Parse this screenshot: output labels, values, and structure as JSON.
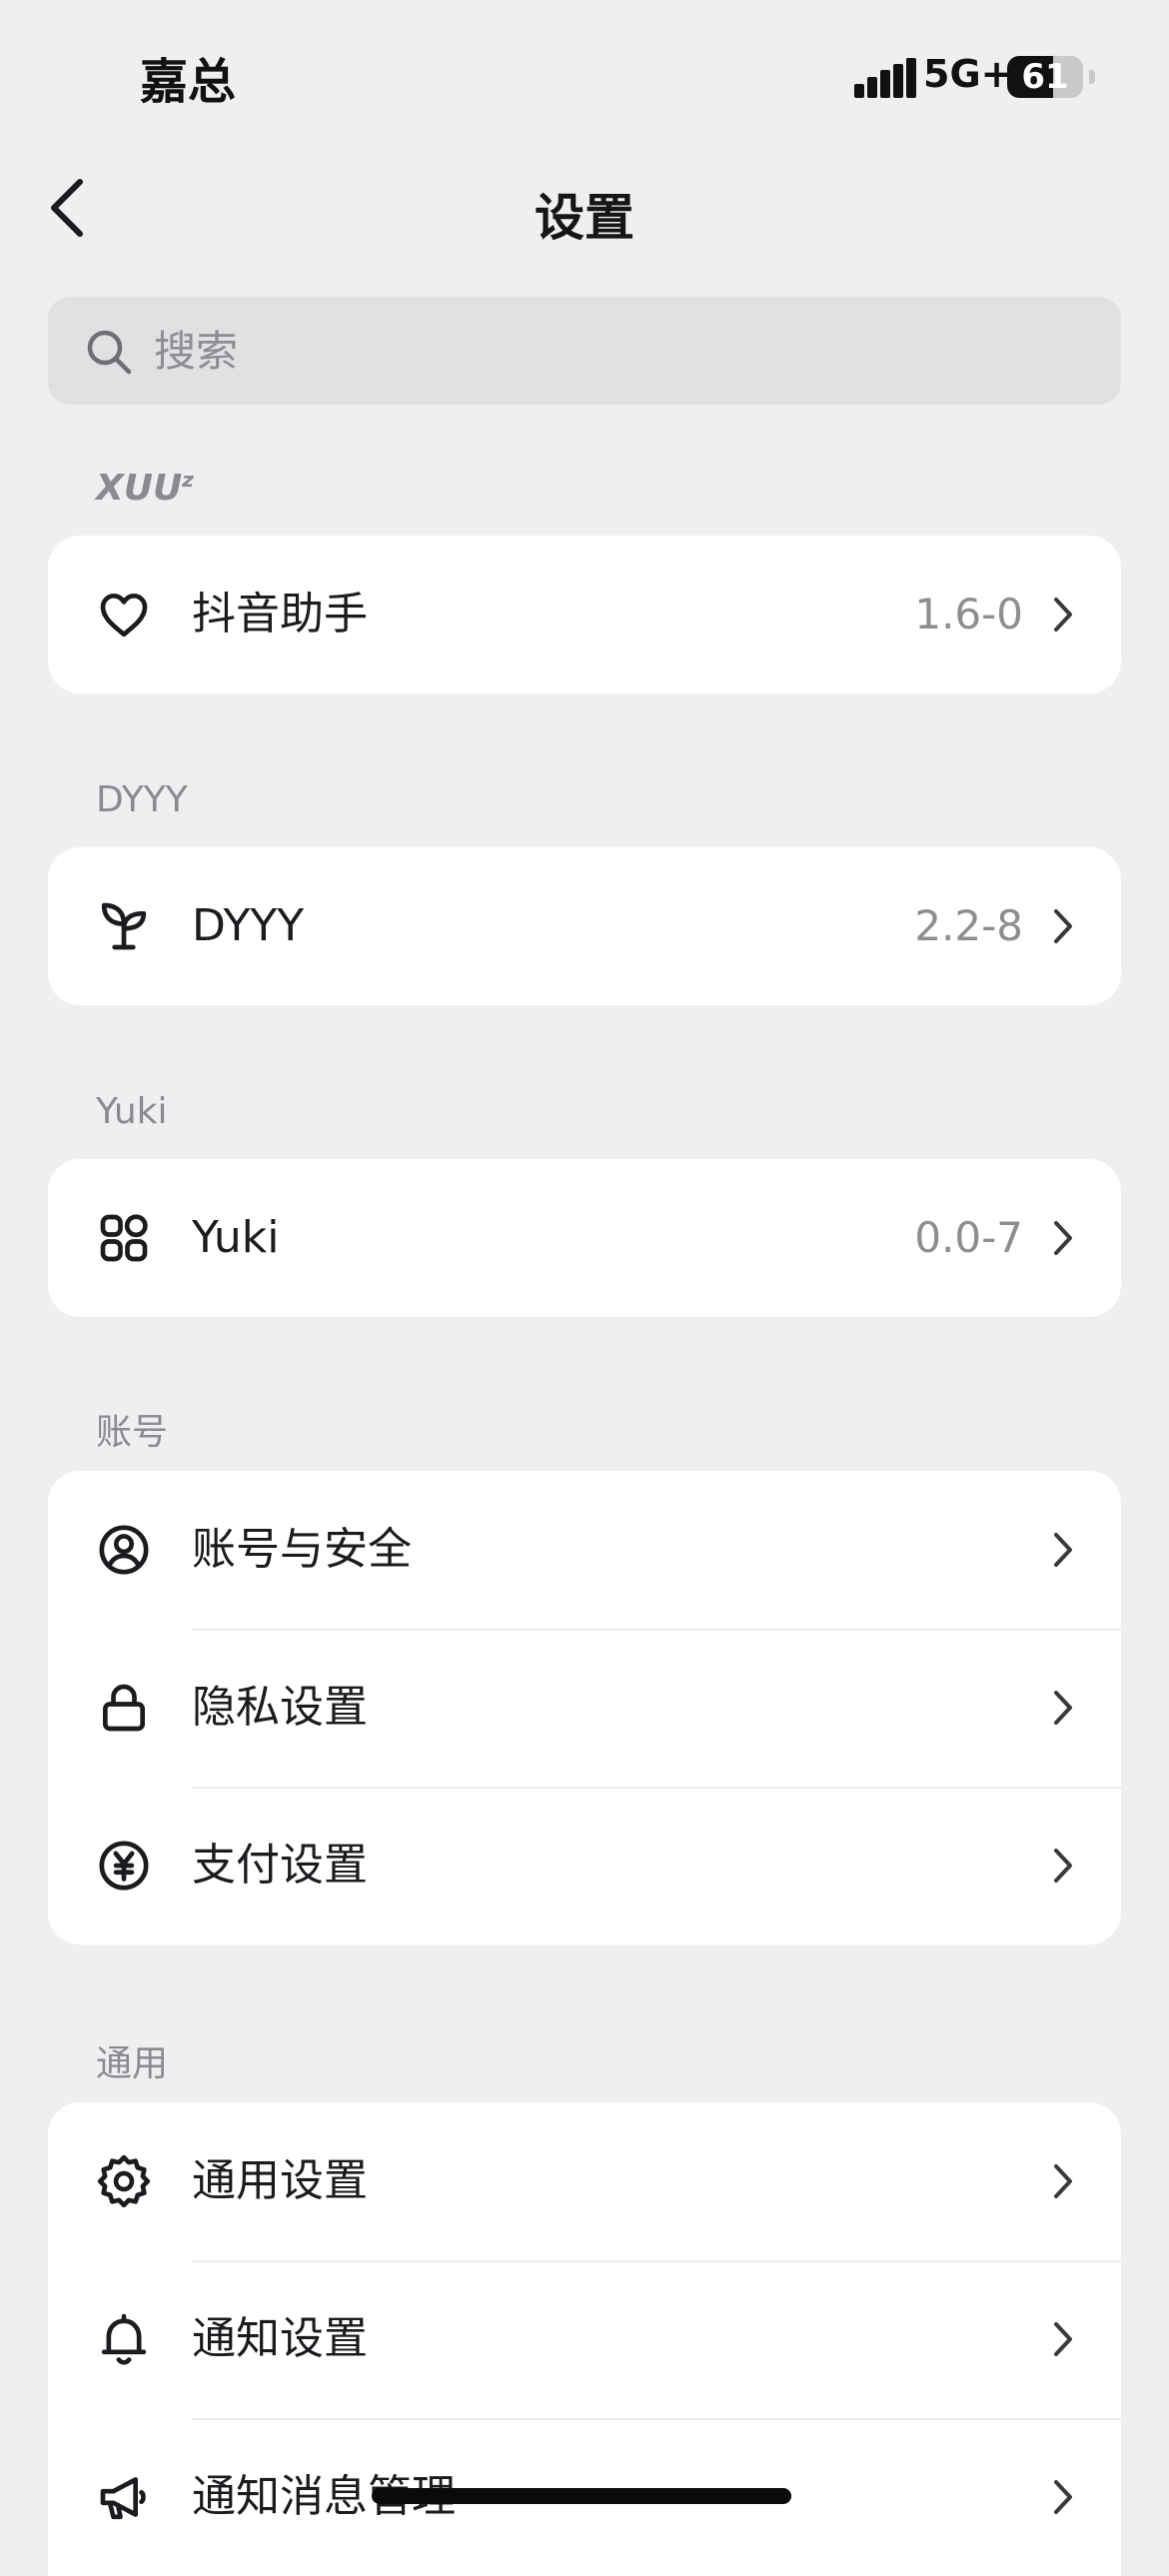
{
  "status_bar": {
    "carrier": "嘉总",
    "network": "5G+",
    "battery": "61",
    "battery_level": 0.61
  },
  "nav": {
    "title": "设置"
  },
  "search": {
    "placeholder": "搜索",
    "value": ""
  },
  "sections": {
    "xuuz": {
      "label": "XUU",
      "label_sup": "z",
      "items": [
        {
          "label": "抖音助手",
          "value": "1.6-0",
          "icon": "heart-icon"
        }
      ]
    },
    "dyyy": {
      "label": "DYYY",
      "items": [
        {
          "label": "DYYY",
          "value": "2.2-8",
          "icon": "sprout-icon"
        }
      ]
    },
    "yuki": {
      "label": "Yuki",
      "items": [
        {
          "label": "Yuki",
          "value": "0.0-7",
          "icon": "apps-grid-icon"
        }
      ]
    },
    "account": {
      "label": "账号",
      "items": [
        {
          "label": "账号与安全",
          "icon": "user-circle-icon"
        },
        {
          "label": "隐私设置",
          "icon": "lock-icon"
        },
        {
          "label": "支付设置",
          "icon": "yen-circle-icon"
        }
      ]
    },
    "general": {
      "label": "通用",
      "items": [
        {
          "label": "通用设置",
          "icon": "gear-icon"
        },
        {
          "label": "通知设置",
          "icon": "bell-icon"
        },
        {
          "label": "通知消息管理",
          "icon": "megaphone-icon"
        }
      ]
    }
  }
}
